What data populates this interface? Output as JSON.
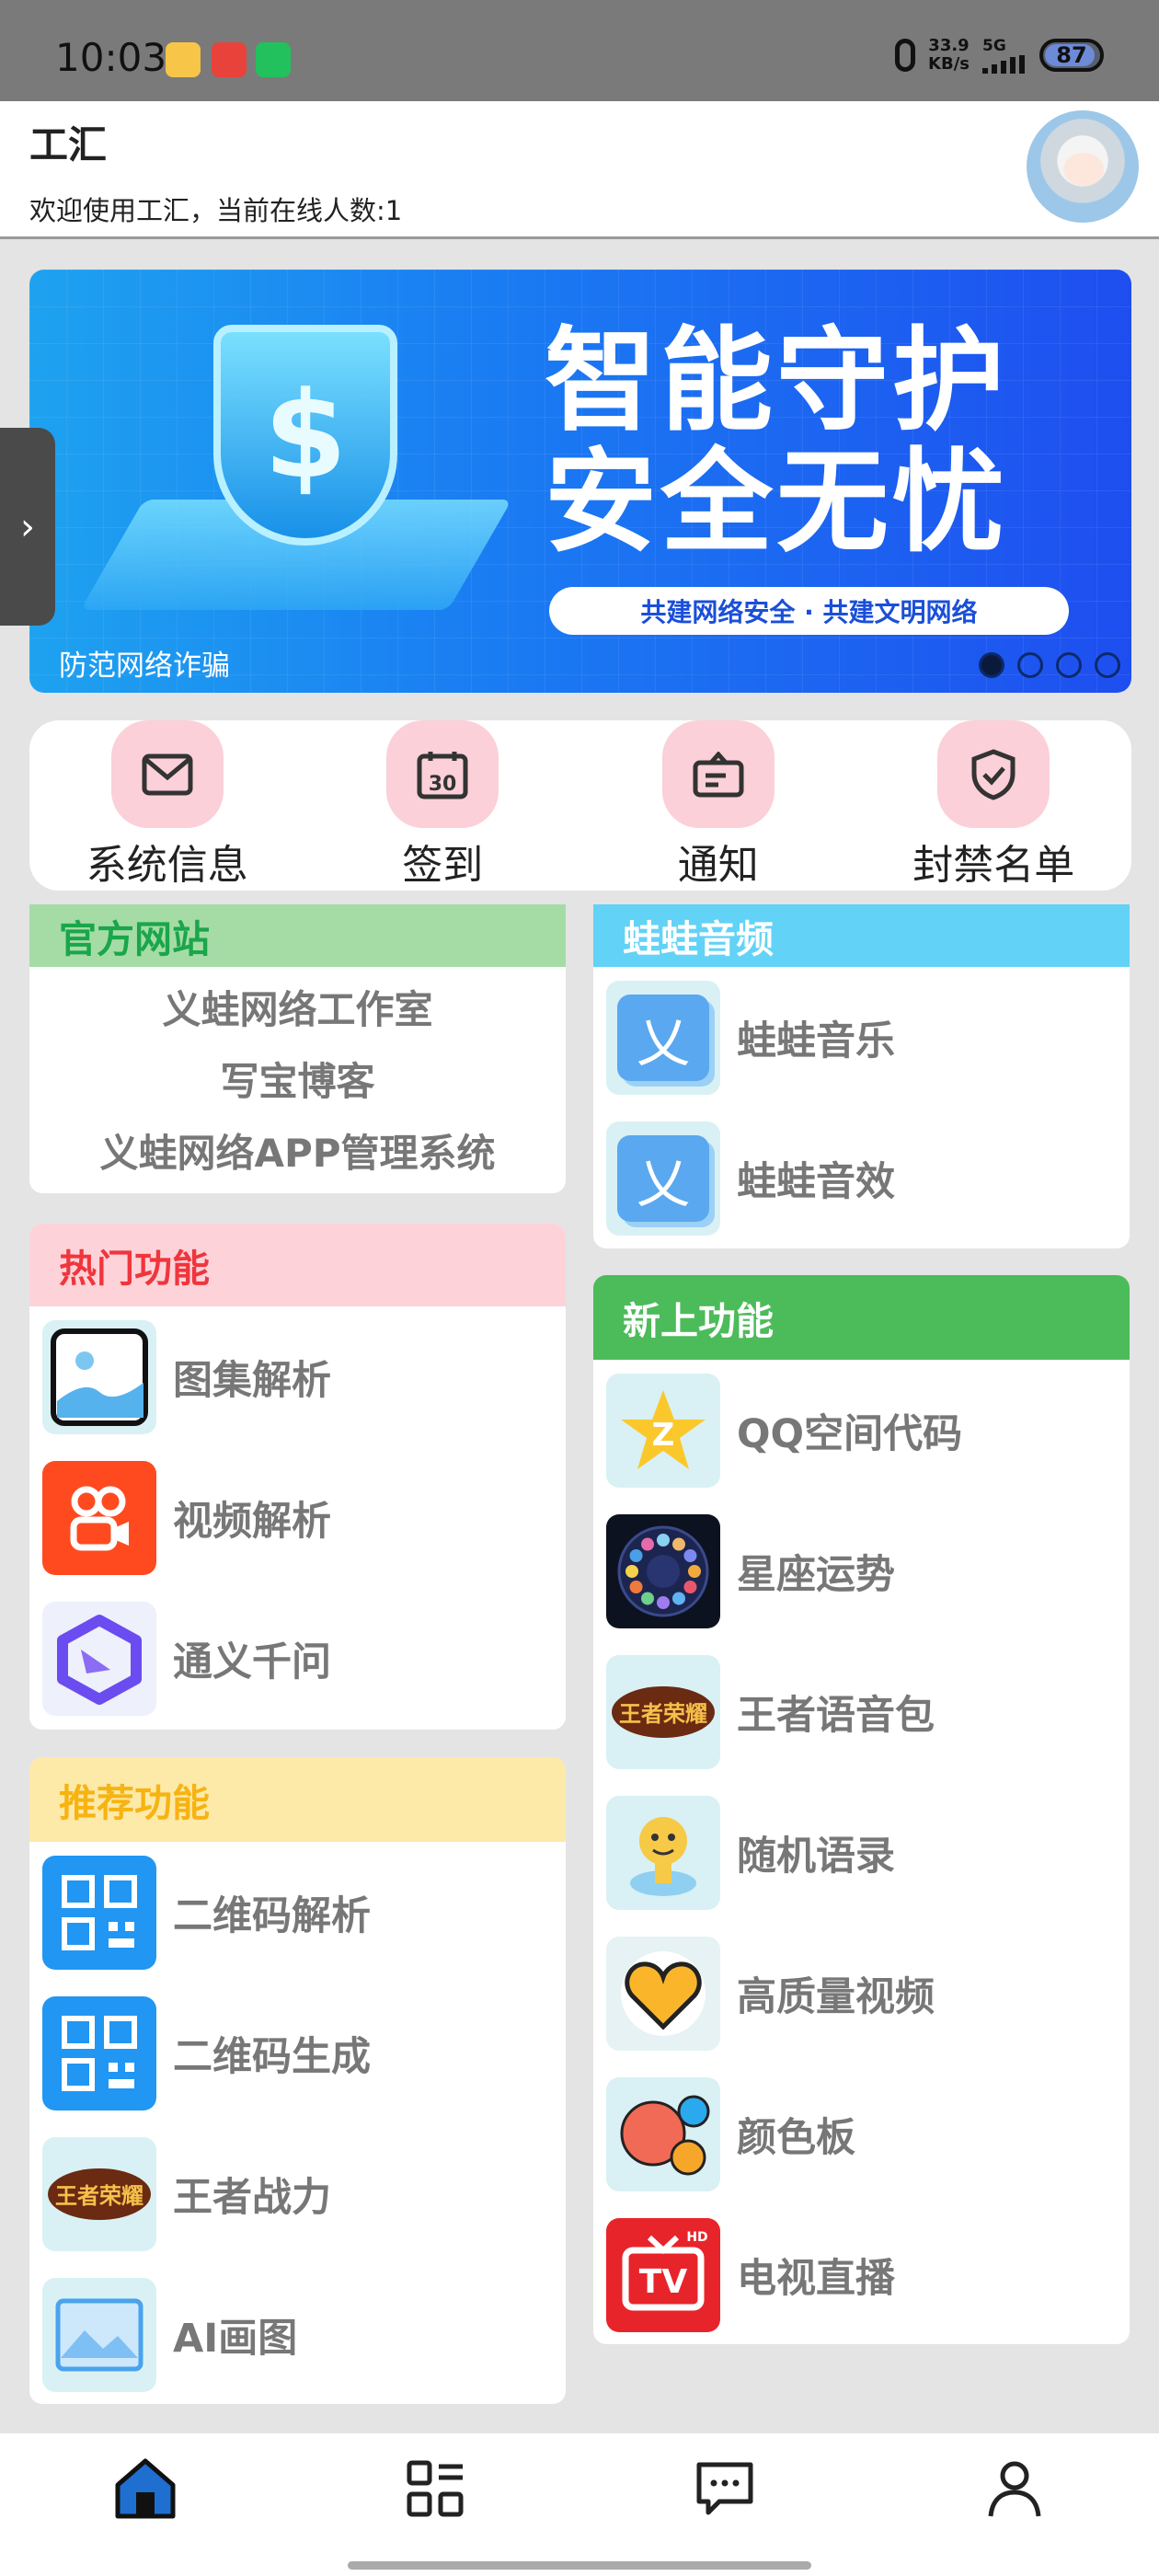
{
  "status_bar": {
    "time": "10:03",
    "net_speed_value": "33.9",
    "net_speed_unit": "KB/s",
    "network": "5G",
    "battery": "87",
    "battery_level": 0.87
  },
  "header": {
    "title": "工汇",
    "subtitle": "欢迎使用工汇，当前在线人数:1"
  },
  "banner": {
    "headline_line1": "智能守护",
    "headline_line2": "安全无忧",
    "slogan": "共建网络安全 · 共建文明网络",
    "caption": "防范网络诈骗",
    "shield_symbol": "$",
    "slide_count": 4,
    "active_slide": 1
  },
  "quick_actions": [
    {
      "label": "系统信息",
      "icon": "envelope-icon"
    },
    {
      "label": "签到",
      "icon": "calendar-icon"
    },
    {
      "label": "通知",
      "icon": "notice-icon"
    },
    {
      "label": "封禁名单",
      "icon": "shield-check-icon"
    }
  ],
  "official": {
    "title": "官方网站",
    "color": "#a5dca6",
    "title_color": "#1aa64a",
    "links": [
      "义蛙网络工作室",
      "写宝博客",
      "义蛙网络APP管理系统"
    ]
  },
  "audio": {
    "title": "蛙蛙音频",
    "color": "#62d2f7",
    "title_color": "#ffffff",
    "items": [
      "蛙蛙音乐",
      "蛙蛙音效"
    ]
  },
  "hot": {
    "title": "热门功能",
    "color": "#fdd3d9",
    "title_color": "#f0353d",
    "items": [
      "图集解析",
      "视频解析",
      "通义千问"
    ]
  },
  "new": {
    "title": "新上功能",
    "color": "#4cbb5a",
    "title_color": "#ffffff",
    "items": [
      "QQ空间代码",
      "星座运势",
      "王者语音包",
      "随机语录",
      "高质量视频",
      "颜色板",
      "电视直播"
    ]
  },
  "recommend": {
    "title": "推荐功能",
    "color": "#fde9a8",
    "title_color": "#f6b312",
    "items": [
      "二维码解析",
      "二维码生成",
      "王者战力",
      "AI画图"
    ]
  },
  "icon_text": {
    "wawa": "乂",
    "qzone": "Z",
    "wangzhe": "王者荣耀",
    "tv": "TV",
    "hd": "HD"
  },
  "bottom_nav": [
    {
      "icon": "home-icon",
      "active": true
    },
    {
      "icon": "apps-icon",
      "active": false
    },
    {
      "icon": "message-icon",
      "active": false
    },
    {
      "icon": "user-icon",
      "active": false
    }
  ]
}
